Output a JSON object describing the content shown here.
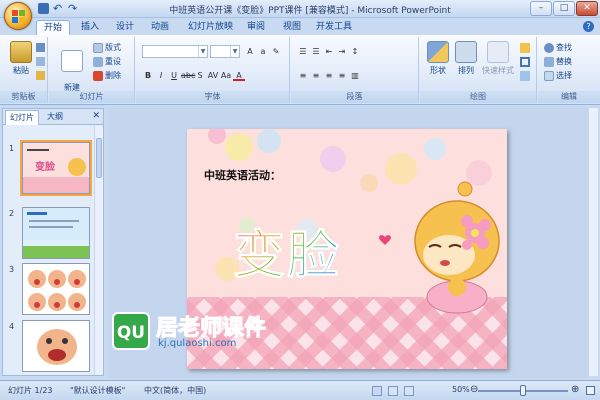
{
  "window": {
    "title": "中班英语公开课《变脸》PPT课件 [兼容模式] - Microsoft PowerPoint",
    "controls": [
      "–",
      "□",
      "✕"
    ]
  },
  "tabs": [
    "开始",
    "插入",
    "设计",
    "动画",
    "幻灯片放映",
    "审阅",
    "视图",
    "开发工具"
  ],
  "ribbon": {
    "clipboard": {
      "paste": "粘贴",
      "label": "剪贴板"
    },
    "slides": {
      "new_slide": "新建\n幻灯片",
      "layout": "版式",
      "reset": "重设",
      "delete": "删除",
      "label": "幻灯片"
    },
    "font": {
      "label": "字体"
    },
    "paragraph": {
      "label": "段落"
    },
    "drawing": {
      "shape": "形状",
      "arrange": "排列",
      "quick_styles": "快速样式",
      "label": "绘图"
    },
    "editing": {
      "find": "查找",
      "replace": "替换",
      "select": "选择",
      "label": "编辑"
    }
  },
  "pane": {
    "tabs": [
      "幻灯片",
      "大纲"
    ],
    "thumbnails": [
      "1",
      "2",
      "3",
      "4"
    ]
  },
  "slide": {
    "heading": "中班英语活动：",
    "big_title": "变脸",
    "logo_text": "居老师课件",
    "logo_url": "kj.qulaoshi.com",
    "logo_mark": "QU"
  },
  "status": {
    "slide_pos": "幻灯片 1/23",
    "template": "\"默认设计模板\"",
    "language": "中文(简体，中国)",
    "zoom": "50%"
  },
  "colors": {
    "accent_orange": "#f5a640",
    "ribbon_blue": "#15428b",
    "slide_pink": "#fde0dd",
    "plaid_pink": "#e97a9a"
  }
}
